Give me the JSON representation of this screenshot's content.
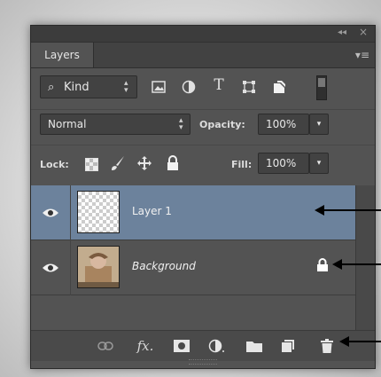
{
  "panel": {
    "collapse_glyph": "◂◂",
    "close_glyph": "×",
    "tab_label": "Layers",
    "menu_glyph": "▾≡"
  },
  "filter": {
    "kind_label": "Kind",
    "icons": [
      "image-filter-icon",
      "adjustment-filter-icon",
      "type-filter-icon",
      "shape-filter-icon",
      "smart-object-filter-icon",
      "filter-toggle-icon"
    ]
  },
  "blend": {
    "mode_value": "Normal",
    "opacity_label": "Opacity:",
    "opacity_value": "100%"
  },
  "lock": {
    "label": "Lock:",
    "fill_label": "Fill:",
    "fill_value": "100%"
  },
  "layers": [
    {
      "name": "Layer 1",
      "selected": true,
      "thumbnail": "transparent-checkerboard"
    },
    {
      "name": "Background",
      "selected": false,
      "thumbnail": "photo",
      "locked": true
    }
  ],
  "bottom_icons": [
    "link-layers-icon",
    "fx-layer-style-icon",
    "add-mask-icon",
    "adjustment-layer-icon",
    "new-group-icon",
    "new-layer-icon",
    "delete-layer-icon"
  ],
  "colors": {
    "panel_bg": "#535353",
    "selected_layer": "#6c829c"
  }
}
